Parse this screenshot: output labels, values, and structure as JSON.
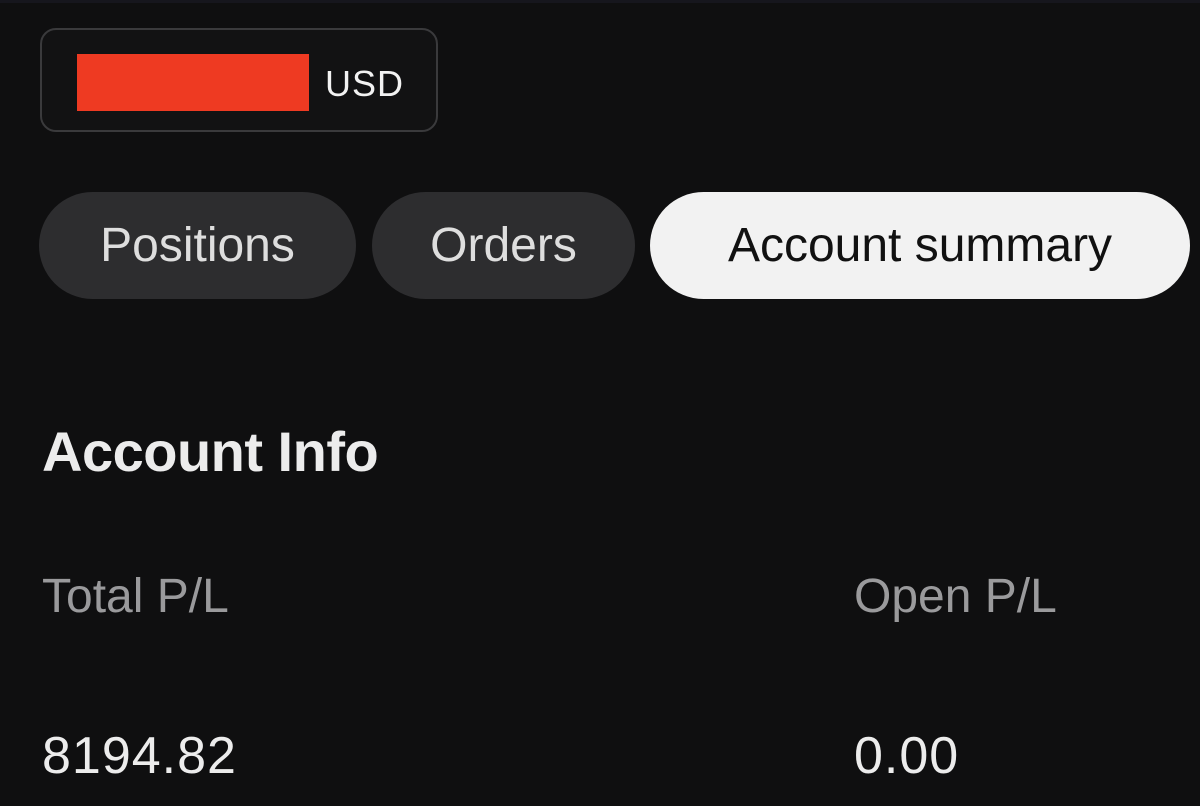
{
  "account": {
    "currency": "USD",
    "redaction_color": "#ee3a22"
  },
  "tabs": [
    {
      "label": "Positions",
      "active": false
    },
    {
      "label": "Orders",
      "active": false
    },
    {
      "label": "Account summary",
      "active": true
    }
  ],
  "account_info": {
    "title": "Account Info",
    "metrics": [
      {
        "label": "Total P/L",
        "value": "8194.82"
      },
      {
        "label": "Open P/L",
        "value": "0.00"
      }
    ]
  },
  "colors": {
    "background": "#0f0f10",
    "tab_inactive": "#2d2d2f",
    "tab_active": "#f2f2f2",
    "label_muted": "#9a9a9c"
  }
}
